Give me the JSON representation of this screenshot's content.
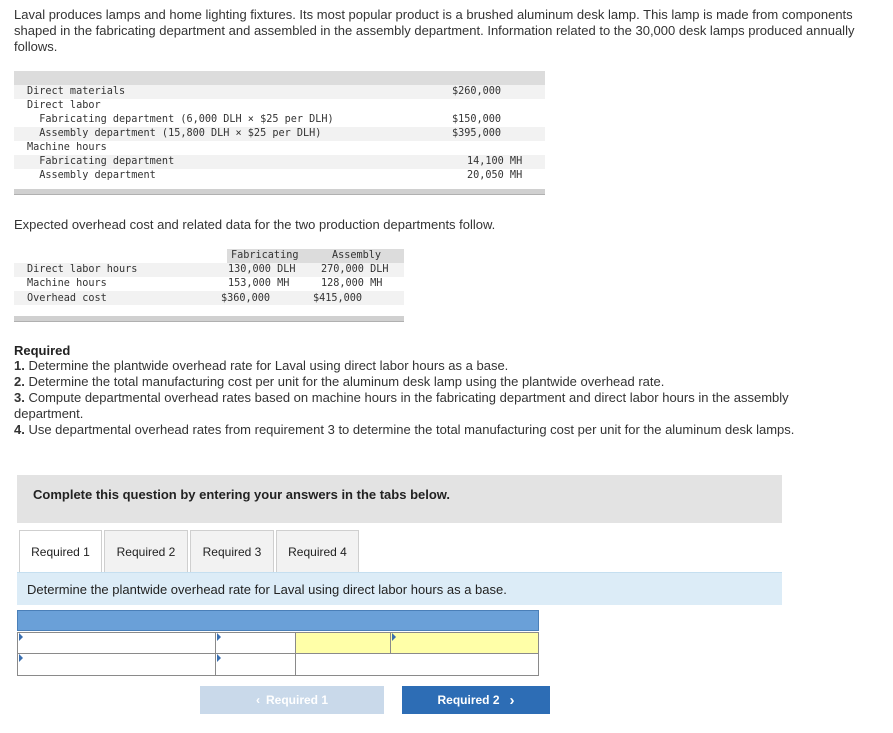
{
  "intro": "Laval produces lamps and home lighting fixtures. Its most popular product is a brushed aluminum desk lamp. This lamp is made from components shaped in the fabricating department and assembled in the assembly department. Information related to the 30,000 desk lamps produced annually follows.",
  "lamp_table": {
    "rows": [
      {
        "label": "Direct materials",
        "value": "$260,000"
      },
      {
        "label": "Direct labor",
        "value": ""
      },
      {
        "label": "  Fabricating department (6,000 DLH × $25 per DLH)",
        "value": "$150,000"
      },
      {
        "label": "  Assembly department (15,800 DLH × $25 per DLH)",
        "value": "$395,000"
      },
      {
        "label": "Machine hours",
        "value": ""
      },
      {
        "label": "  Fabricating department",
        "value": "14,100 MH"
      },
      {
        "label": "  Assembly department",
        "value": "20,050 MH"
      }
    ]
  },
  "overhead_intro": "Expected overhead cost and related data for the two production departments follow.",
  "overhead_table": {
    "headers": [
      "Fabricating",
      "Assembly"
    ],
    "rows": [
      {
        "label": "Direct labor hours",
        "fab": "130,000 DLH",
        "asm": "270,000 DLH"
      },
      {
        "label": "Machine hours",
        "fab": "153,000 MH",
        "asm": "128,000 MH"
      },
      {
        "label": "Overhead cost",
        "fab": "$360,000",
        "asm": "$415,000"
      }
    ]
  },
  "required": {
    "heading": "Required",
    "items": [
      {
        "num": "1.",
        "text": " Determine the plantwide overhead rate for Laval using direct labor hours as a base."
      },
      {
        "num": "2.",
        "text": " Determine the total manufacturing cost per unit for the aluminum desk lamp using the plantwide overhead rate."
      },
      {
        "num": "3.",
        "text": " Compute departmental overhead rates based on machine hours in the fabricating department and direct labor hours in the assembly department."
      },
      {
        "num": "4.",
        "text": " Use departmental overhead rates from requirement 3 to determine the total manufacturing cost per unit for the aluminum desk lamps."
      }
    ]
  },
  "complete_banner": "Complete this question by entering your answers in the tabs below.",
  "tabs": [
    "Required 1",
    "Required 2",
    "Required 3",
    "Required 4"
  ],
  "active_tab": "Required 1",
  "instruction": "Determine the plantwide overhead rate for Laval using direct labor hours as a base.",
  "answer_grid": {
    "row1": [
      "",
      "",
      "",
      ""
    ],
    "row2": [
      "",
      "",
      ""
    ]
  },
  "nav": {
    "prev_label": "Required 1",
    "prev_icon": "chevron-left-icon",
    "next_label": "Required 2",
    "next_icon": "chevron-right-icon"
  },
  "colors": {
    "tab_header_blue": "#6aa0d8",
    "input_yellow": "#ffffa8",
    "instruction_bg": "#dcecf7",
    "next_button": "#2d6db5"
  }
}
